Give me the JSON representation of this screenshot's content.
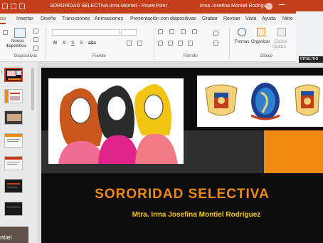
{
  "window": {
    "title": "SORORIDAD SELECTIVA Irma Montiel  -  PowerPoint",
    "user": "Irma Josefina Montiel Rodriguez"
  },
  "tabs": [
    "Inicio",
    "Insertar",
    "Diseño",
    "Transiciones",
    "Animaciones",
    "Presentación con diapositivas",
    "Grabar",
    "Revisar",
    "Vista",
    "Ayuda",
    "Nitro"
  ],
  "ribbon": {
    "new_slide_line1": "Nueva",
    "new_slide_line2": "diapositiva",
    "groups": [
      "Diapositivas",
      "Fuente",
      "Párrafo",
      "Dibujo"
    ],
    "shapes_label": "Formas",
    "arrange_label": "Organizar",
    "quick_styles_line1": "Estilos",
    "quick_styles_line2": "rápidos",
    "font_buttons": [
      "N",
      "K",
      "S",
      "S",
      "abc"
    ]
  },
  "thumbnails": [
    {
      "number": "1",
      "selected": true
    },
    {
      "number": "",
      "selected": false
    },
    {
      "number": "",
      "selected": false
    },
    {
      "number": "",
      "selected": false
    },
    {
      "number": "",
      "selected": false
    },
    {
      "number": "",
      "selected": false
    }
  ],
  "slide": {
    "title": "SORORIDAD SELECTIVA",
    "subtitle": "Mtra. Irma Josefina Montiel Rodríguez"
  },
  "video": {
    "top_right_name": "irma.mo",
    "bottom_left_name": "ntiel"
  },
  "colors": {
    "ppt_accent": "#c43e1c",
    "slide_bg": "#0d0d0d",
    "title_orange": "#f28a12",
    "subtitle_yellow": "#f3c514"
  }
}
